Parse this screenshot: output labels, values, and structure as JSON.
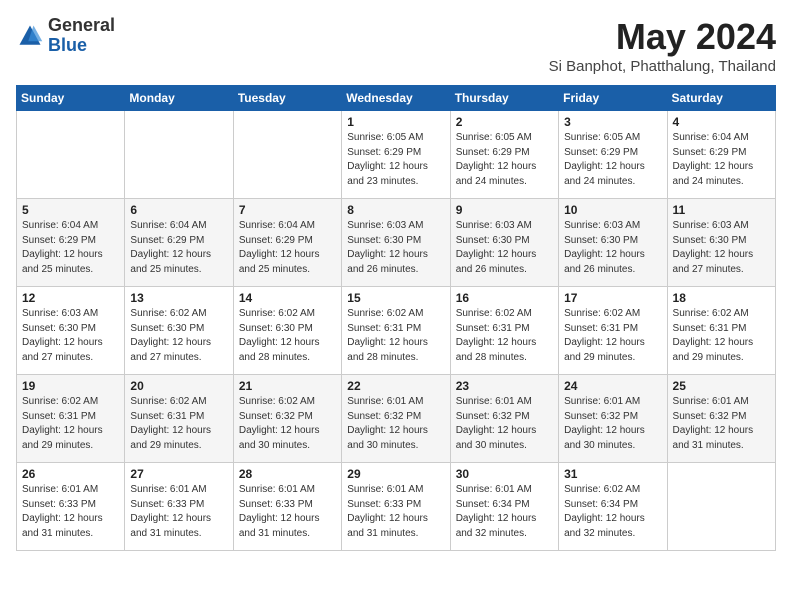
{
  "logo": {
    "general": "General",
    "blue": "Blue"
  },
  "title": "May 2024",
  "subtitle": "Si Banphot, Phatthalung, Thailand",
  "days_header": [
    "Sunday",
    "Monday",
    "Tuesday",
    "Wednesday",
    "Thursday",
    "Friday",
    "Saturday"
  ],
  "weeks": [
    [
      {
        "day": "",
        "info": ""
      },
      {
        "day": "",
        "info": ""
      },
      {
        "day": "",
        "info": ""
      },
      {
        "day": "1",
        "info": "Sunrise: 6:05 AM\nSunset: 6:29 PM\nDaylight: 12 hours and 23 minutes."
      },
      {
        "day": "2",
        "info": "Sunrise: 6:05 AM\nSunset: 6:29 PM\nDaylight: 12 hours and 24 minutes."
      },
      {
        "day": "3",
        "info": "Sunrise: 6:05 AM\nSunset: 6:29 PM\nDaylight: 12 hours and 24 minutes."
      },
      {
        "day": "4",
        "info": "Sunrise: 6:04 AM\nSunset: 6:29 PM\nDaylight: 12 hours and 24 minutes."
      }
    ],
    [
      {
        "day": "5",
        "info": "Sunrise: 6:04 AM\nSunset: 6:29 PM\nDaylight: 12 hours and 25 minutes."
      },
      {
        "day": "6",
        "info": "Sunrise: 6:04 AM\nSunset: 6:29 PM\nDaylight: 12 hours and 25 minutes."
      },
      {
        "day": "7",
        "info": "Sunrise: 6:04 AM\nSunset: 6:29 PM\nDaylight: 12 hours and 25 minutes."
      },
      {
        "day": "8",
        "info": "Sunrise: 6:03 AM\nSunset: 6:30 PM\nDaylight: 12 hours and 26 minutes."
      },
      {
        "day": "9",
        "info": "Sunrise: 6:03 AM\nSunset: 6:30 PM\nDaylight: 12 hours and 26 minutes."
      },
      {
        "day": "10",
        "info": "Sunrise: 6:03 AM\nSunset: 6:30 PM\nDaylight: 12 hours and 26 minutes."
      },
      {
        "day": "11",
        "info": "Sunrise: 6:03 AM\nSunset: 6:30 PM\nDaylight: 12 hours and 27 minutes."
      }
    ],
    [
      {
        "day": "12",
        "info": "Sunrise: 6:03 AM\nSunset: 6:30 PM\nDaylight: 12 hours and 27 minutes."
      },
      {
        "day": "13",
        "info": "Sunrise: 6:02 AM\nSunset: 6:30 PM\nDaylight: 12 hours and 27 minutes."
      },
      {
        "day": "14",
        "info": "Sunrise: 6:02 AM\nSunset: 6:30 PM\nDaylight: 12 hours and 28 minutes."
      },
      {
        "day": "15",
        "info": "Sunrise: 6:02 AM\nSunset: 6:31 PM\nDaylight: 12 hours and 28 minutes."
      },
      {
        "day": "16",
        "info": "Sunrise: 6:02 AM\nSunset: 6:31 PM\nDaylight: 12 hours and 28 minutes."
      },
      {
        "day": "17",
        "info": "Sunrise: 6:02 AM\nSunset: 6:31 PM\nDaylight: 12 hours and 29 minutes."
      },
      {
        "day": "18",
        "info": "Sunrise: 6:02 AM\nSunset: 6:31 PM\nDaylight: 12 hours and 29 minutes."
      }
    ],
    [
      {
        "day": "19",
        "info": "Sunrise: 6:02 AM\nSunset: 6:31 PM\nDaylight: 12 hours and 29 minutes."
      },
      {
        "day": "20",
        "info": "Sunrise: 6:02 AM\nSunset: 6:31 PM\nDaylight: 12 hours and 29 minutes."
      },
      {
        "day": "21",
        "info": "Sunrise: 6:02 AM\nSunset: 6:32 PM\nDaylight: 12 hours and 30 minutes."
      },
      {
        "day": "22",
        "info": "Sunrise: 6:01 AM\nSunset: 6:32 PM\nDaylight: 12 hours and 30 minutes."
      },
      {
        "day": "23",
        "info": "Sunrise: 6:01 AM\nSunset: 6:32 PM\nDaylight: 12 hours and 30 minutes."
      },
      {
        "day": "24",
        "info": "Sunrise: 6:01 AM\nSunset: 6:32 PM\nDaylight: 12 hours and 30 minutes."
      },
      {
        "day": "25",
        "info": "Sunrise: 6:01 AM\nSunset: 6:32 PM\nDaylight: 12 hours and 31 minutes."
      }
    ],
    [
      {
        "day": "26",
        "info": "Sunrise: 6:01 AM\nSunset: 6:33 PM\nDaylight: 12 hours and 31 minutes."
      },
      {
        "day": "27",
        "info": "Sunrise: 6:01 AM\nSunset: 6:33 PM\nDaylight: 12 hours and 31 minutes."
      },
      {
        "day": "28",
        "info": "Sunrise: 6:01 AM\nSunset: 6:33 PM\nDaylight: 12 hours and 31 minutes."
      },
      {
        "day": "29",
        "info": "Sunrise: 6:01 AM\nSunset: 6:33 PM\nDaylight: 12 hours and 31 minutes."
      },
      {
        "day": "30",
        "info": "Sunrise: 6:01 AM\nSunset: 6:34 PM\nDaylight: 12 hours and 32 minutes."
      },
      {
        "day": "31",
        "info": "Sunrise: 6:02 AM\nSunset: 6:34 PM\nDaylight: 12 hours and 32 minutes."
      },
      {
        "day": "",
        "info": ""
      }
    ]
  ]
}
